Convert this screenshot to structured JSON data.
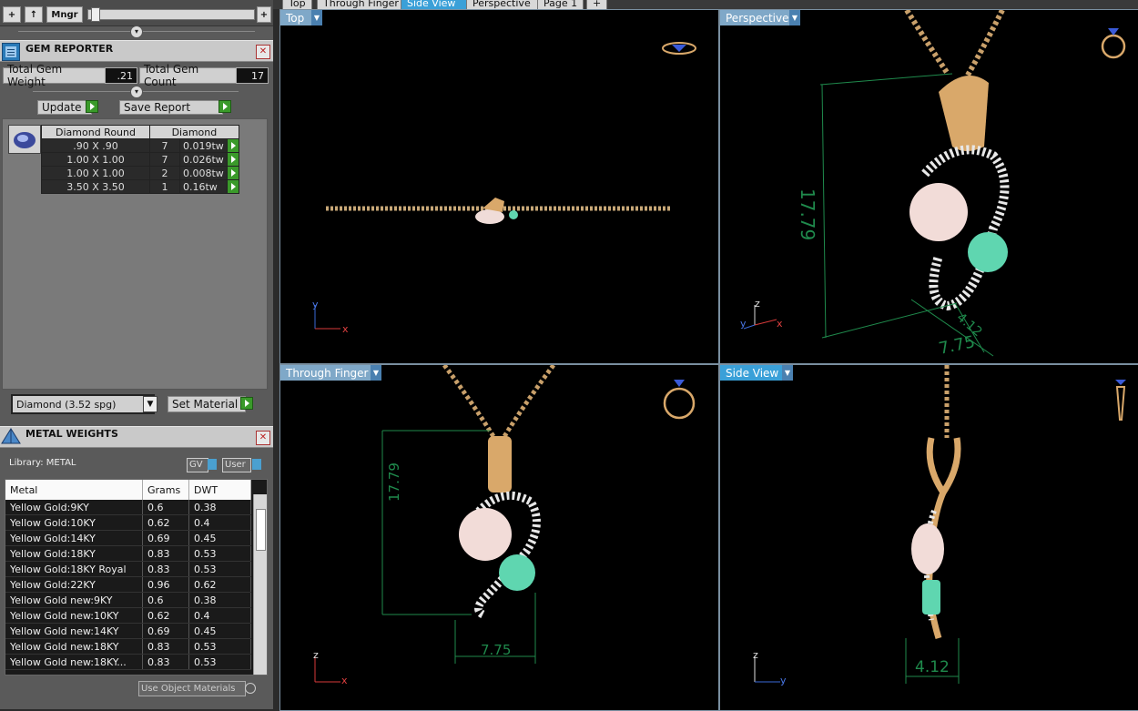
{
  "toolbar": {
    "add_label": "+",
    "up_label": "↑",
    "manager_label": "Mngr",
    "plus_label": "+"
  },
  "gem_reporter": {
    "title": "GEM REPORTER",
    "total_weight_label": "Total Gem Weight",
    "total_weight_value": ".21",
    "total_count_label": "Total Gem Count",
    "total_count_value": "17",
    "update_label": "Update",
    "save_report_label": "Save Report",
    "table_headers": [
      "Diamond Round",
      "Diamond"
    ],
    "rows": [
      {
        "size": ".90 X .90",
        "count": "7",
        "weight": "0.019tw"
      },
      {
        "size": "1.00 X 1.00",
        "count": "7",
        "weight": "0.026tw"
      },
      {
        "size": "1.00 X 1.00",
        "count": "2",
        "weight": "0.008tw"
      },
      {
        "size": "3.50 X 3.50",
        "count": "1",
        "weight": "0.16tw"
      }
    ],
    "material_select": "Diamond    (3.52 spg)",
    "set_material_label": "Set Material"
  },
  "metal_weights": {
    "title": "METAL WEIGHTS",
    "library_label": "Library: METAL",
    "gv_label": "GV",
    "user_label": "User",
    "headers": [
      "Metal",
      "Grams",
      "DWT"
    ],
    "rows": [
      {
        "metal": "Yellow Gold:9KY",
        "grams": "0.6",
        "dwt": "0.38"
      },
      {
        "metal": "Yellow Gold:10KY",
        "grams": "0.62",
        "dwt": "0.4"
      },
      {
        "metal": "Yellow Gold:14KY",
        "grams": "0.69",
        "dwt": "0.45"
      },
      {
        "metal": "Yellow Gold:18KY",
        "grams": "0.83",
        "dwt": "0.53"
      },
      {
        "metal": "Yellow Gold:18KY Royal",
        "grams": "0.83",
        "dwt": "0.53"
      },
      {
        "metal": "Yellow Gold:22KY",
        "grams": "0.96",
        "dwt": "0.62"
      },
      {
        "metal": "Yellow Gold new:9KY",
        "grams": "0.6",
        "dwt": "0.38"
      },
      {
        "metal": "Yellow Gold new:10KY",
        "grams": "0.62",
        "dwt": "0.4"
      },
      {
        "metal": "Yellow Gold new:14KY",
        "grams": "0.69",
        "dwt": "0.45"
      },
      {
        "metal": "Yellow Gold new:18KY",
        "grams": "0.83",
        "dwt": "0.53"
      },
      {
        "metal": "Yellow Gold new:18KY...",
        "grams": "0.83",
        "dwt": "0.53"
      }
    ],
    "use_object_materials_label": "Use Object Materials"
  },
  "view_tabs": [
    "Top",
    "Through Finger",
    "Side View",
    "Perspective",
    "Page 1",
    "+"
  ],
  "viewports": {
    "top": {
      "label": "Top",
      "axis_v": "y",
      "axis_h": "x"
    },
    "perspective": {
      "label": "Perspective",
      "axis_v": "z",
      "axis_h": "x",
      "axis_d": "y",
      "dim_height": "17.79",
      "dim_width": "7.75",
      "dim_depth": "4.12"
    },
    "through_finger": {
      "label": "Through Finger",
      "axis_v": "z",
      "axis_h": "x",
      "dim_height": "17.79",
      "dim_width": "7.75"
    },
    "side_view": {
      "label": "Side View",
      "axis_v": "z",
      "axis_h": "y",
      "dim_width": "4.12"
    }
  },
  "colors": {
    "accent": "#3aa0d8",
    "gold": "#d9a86a",
    "emerald": "#5fd6b0",
    "pearl": "#f2dcd8",
    "dimension": "#1f8a4c"
  }
}
